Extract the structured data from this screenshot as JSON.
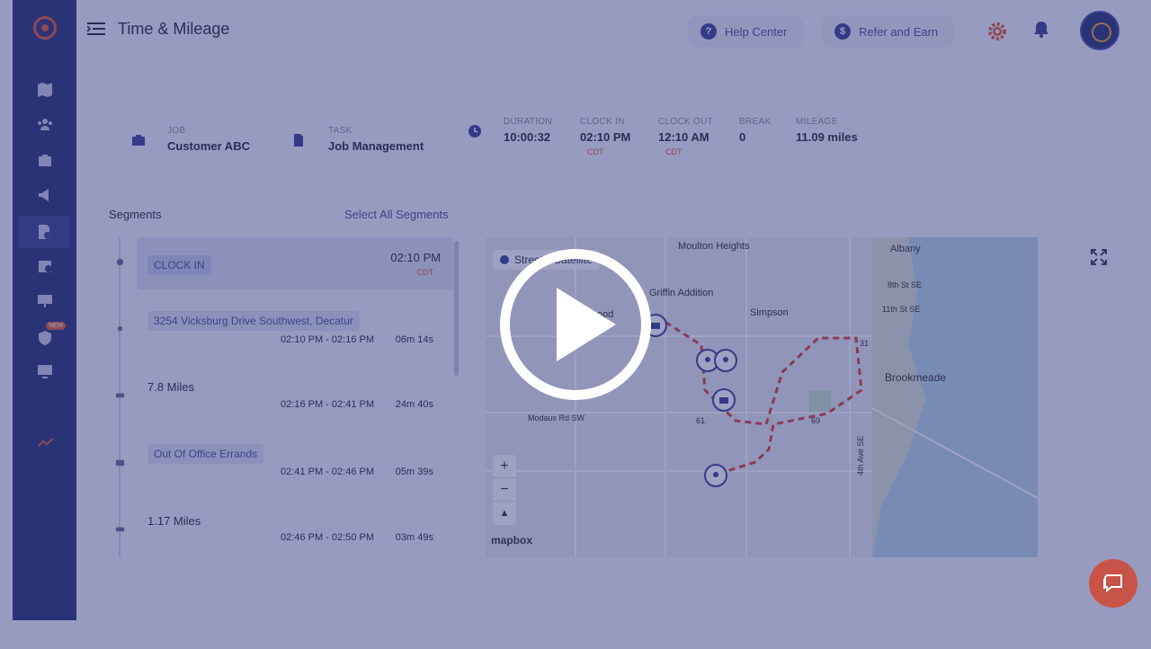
{
  "app": {
    "title": "Time & Mileage"
  },
  "header": {
    "help_label": "Help Center",
    "refer_label": "Refer and Earn",
    "help_glyph": "?",
    "refer_glyph": "$"
  },
  "sidebar": {
    "items": [
      {
        "icon": "map-icon"
      },
      {
        "icon": "team-icon"
      },
      {
        "icon": "briefcase-icon"
      },
      {
        "icon": "megaphone-icon"
      },
      {
        "icon": "timesheet-icon",
        "active": true
      },
      {
        "icon": "calendar-clock-icon"
      },
      {
        "icon": "presentation-icon"
      },
      {
        "icon": "shield-icon",
        "badge": "NEW"
      },
      {
        "icon": "monitor-icon"
      },
      {
        "icon": "trend-icon"
      }
    ]
  },
  "summary": {
    "job_label": "JOB",
    "job_value": "Customer ABC",
    "task_label": "TASK",
    "task_value": "Job Management",
    "duration_label": "DURATION",
    "duration_value": "10:00:32",
    "clock_in_label": "CLOCK IN",
    "clock_in_value": "02:10 PM",
    "clock_in_tz": "CDT",
    "clock_out_label": "CLOCK OUT",
    "clock_out_value": "12:10 AM",
    "clock_out_tz": "CDT",
    "break_label": "BREAK",
    "break_value": "0",
    "mileage_label": "MILEAGE",
    "mileage_value": "11.09 miles"
  },
  "segments": {
    "title": "Segments",
    "select_all": "Select All Segments",
    "items": [
      {
        "kind": "clock-in",
        "label": "CLOCK IN",
        "time": "02:10 PM",
        "tz": "CDT"
      },
      {
        "kind": "stop",
        "label": "3254 Vicksburg Drive Southwest, Decatur",
        "time": "02:10 PM - 02:16 PM",
        "duration": "06m 14s"
      },
      {
        "kind": "drive",
        "label": "7.8 Miles",
        "time": "02:16 PM - 02:41 PM",
        "duration": "24m 40s"
      },
      {
        "kind": "stop",
        "label": "Out Of Office Errands",
        "time": "02:41 PM - 02:46 PM",
        "duration": "05m 39s"
      },
      {
        "kind": "drive",
        "label": "1.17 Miles",
        "time": "02:46 PM - 02:50 PM",
        "duration": "03m 49s"
      }
    ]
  },
  "map": {
    "style_label": "Streets",
    "style_label_2": "Satellite",
    "attribution": "mapbox",
    "zoom_in": "+",
    "zoom_out": "−",
    "compass": "▲",
    "labels": {
      "moulton": "Moulton Heights",
      "albany": "Albany",
      "st8": "8th St SE",
      "st11": "11th St SE",
      "griffin": "Griffin Addition",
      "simpson": "Simpson",
      "brookmeade": "Brookmeade",
      "modaus": "Modaus Rd SW",
      "ave4": "4th Ave SE",
      "route31": "31",
      "route61": "61",
      "route69": "69",
      "road": "ood"
    },
    "route_color": "#d7473a"
  }
}
